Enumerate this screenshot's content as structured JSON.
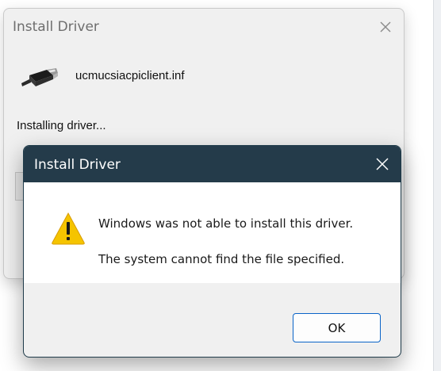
{
  "background_dialog": {
    "title": "Install Driver",
    "file_name": "ucmucsiacpiclient.inf",
    "status": "Installing driver..."
  },
  "error_dialog": {
    "title": "Install Driver",
    "message_line1": "Windows was not able to install this driver.",
    "message_line2": "The system cannot find the file specified.",
    "ok_label": "OK"
  },
  "icons": {
    "close": "close-icon",
    "usb": "usb-cable-icon",
    "warning": "warning-icon"
  },
  "colors": {
    "error_titlebar": "#243b4a",
    "ok_button_border": "#0a64c8",
    "warning_fill": "#f5c400"
  }
}
